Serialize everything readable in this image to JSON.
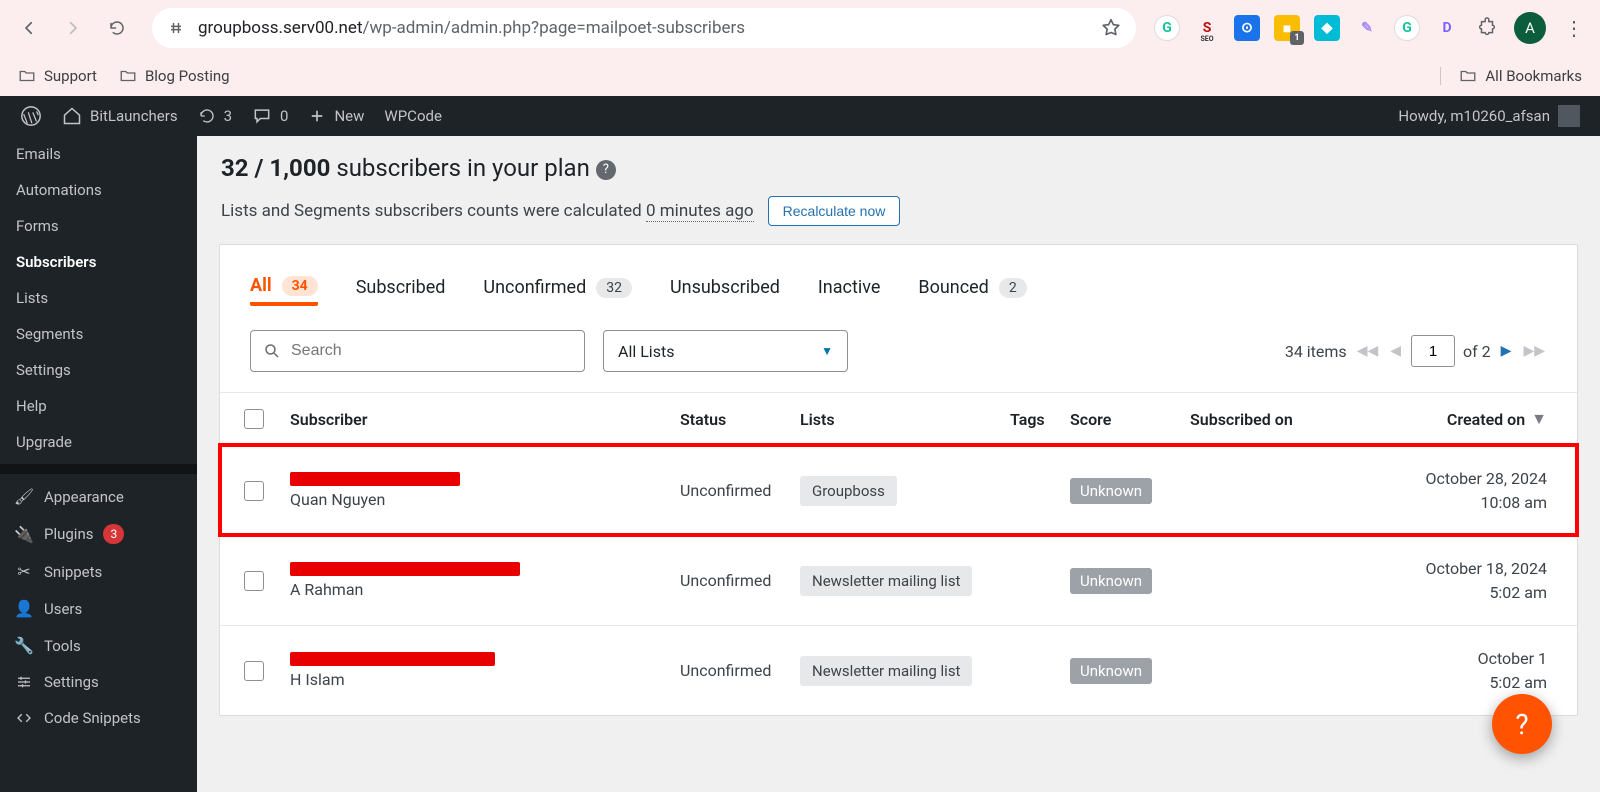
{
  "browser": {
    "url_host": "groupboss.serv00.net",
    "url_path": "/wp-admin/admin.php?page=mailpoet-subscribers",
    "avatar_initial": "A",
    "ext_badge": "1",
    "bookmarks": {
      "support": "Support",
      "blog": "Blog Posting",
      "all": "All Bookmarks"
    }
  },
  "adminbar": {
    "site": "BitLaunchers",
    "updates": "3",
    "comments": "0",
    "new": "New",
    "wpcode": "WPCode",
    "howdy": "Howdy, m10260_afsan"
  },
  "sidebar": {
    "emails": "Emails",
    "automations": "Automations",
    "forms": "Forms",
    "subscribers": "Subscribers",
    "lists": "Lists",
    "segments": "Segments",
    "settings": "Settings",
    "help": "Help",
    "upgrade": "Upgrade",
    "appearance": "Appearance",
    "plugins": "Plugins",
    "plugins_count": "3",
    "snippets": "Snippets",
    "users": "Users",
    "tools": "Tools",
    "wp_settings": "Settings",
    "code_snippets": "Code Snippets"
  },
  "plan": {
    "count": "32 / 1,000",
    "label": "subscribers in your plan",
    "calc_prefix": "Lists and Segments subscribers counts were calculated",
    "calc_time": "0 minutes ago",
    "recalculate": "Recalculate now"
  },
  "tabs": {
    "all": "All",
    "all_n": "34",
    "subscribed": "Subscribed",
    "unconfirmed": "Unconfirmed",
    "unconfirmed_n": "32",
    "unsubscribed": "Unsubscribed",
    "inactive": "Inactive",
    "bounced": "Bounced",
    "bounced_n": "2"
  },
  "toolbar": {
    "search_placeholder": "Search",
    "list_select": "All Lists",
    "items_label": "34 items",
    "page": "1",
    "of": "of 2"
  },
  "columns": {
    "subscriber": "Subscriber",
    "status": "Status",
    "lists": "Lists",
    "tags": "Tags",
    "score": "Score",
    "subscribed_on": "Subscribed on",
    "created_on": "Created on"
  },
  "rows": [
    {
      "name": "Quan Nguyen",
      "status": "Unconfirmed",
      "list": "Groupboss",
      "score": "Unknown",
      "date": "October 28, 2024",
      "time": "10:08 am",
      "redact_w": 170
    },
    {
      "name": "A Rahman",
      "status": "Unconfirmed",
      "list": "Newsletter mailing list",
      "score": "Unknown",
      "date": "October 18, 2024",
      "time": "5:02 am",
      "redact_w": 230
    },
    {
      "name": "H Islam",
      "status": "Unconfirmed",
      "list": "Newsletter mailing list",
      "score": "Unknown",
      "date": "October 1",
      "time": "5:02 am",
      "redact_w": 205
    }
  ]
}
